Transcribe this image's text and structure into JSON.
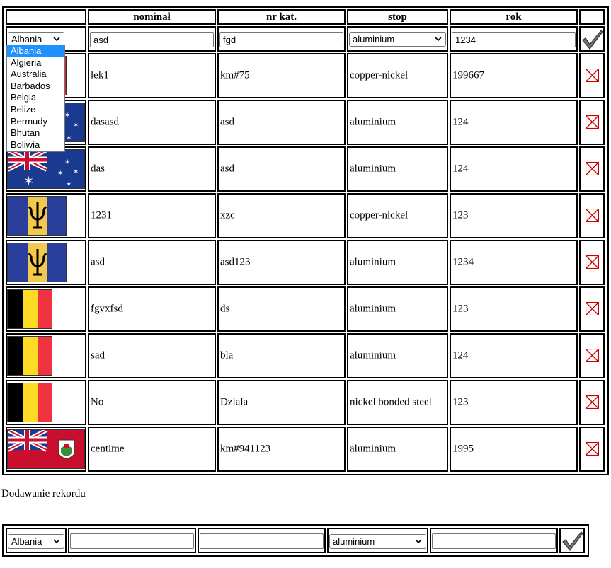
{
  "table": {
    "headers": [
      "",
      "nominał",
      "nr kat.",
      "stop",
      "rok",
      ""
    ],
    "filter_row": {
      "country": "Albania",
      "nominal": "asd",
      "catalog": "fgd",
      "alloy": "aluminium",
      "year": "1234"
    },
    "country_dropdown": {
      "options": [
        "Albania",
        "Algieria",
        "Australia",
        "Barbados",
        "Belgia",
        "Belize",
        "Bermudy",
        "Bhutan",
        "Boliwia"
      ],
      "selected": "Albania"
    },
    "rows": [
      {
        "flag": "albania-flag",
        "nominal": "lek1",
        "catalog": "km#75",
        "alloy": "copper-nickel",
        "year": "199667"
      },
      {
        "flag": "australia-flag",
        "nominal": "dasasd",
        "catalog": "asd",
        "alloy": "aluminium",
        "year": "124"
      },
      {
        "flag": "australia-flag",
        "nominal": "das",
        "catalog": "asd",
        "alloy": "aluminium",
        "year": "124"
      },
      {
        "flag": "barbados-flag",
        "nominal": "1231",
        "catalog": "xzc",
        "alloy": "copper-nickel",
        "year": "123"
      },
      {
        "flag": "barbados-flag",
        "nominal": "asd",
        "catalog": "asd123",
        "alloy": "aluminium",
        "year": "1234"
      },
      {
        "flag": "belgium-flag",
        "nominal": "fgvxfsd",
        "catalog": "ds",
        "alloy": "aluminium",
        "year": "123"
      },
      {
        "flag": "belgium-flag",
        "nominal": "sad",
        "catalog": "bla",
        "alloy": "aluminium",
        "year": "124"
      },
      {
        "flag": "belgium-flag",
        "nominal": "No",
        "catalog": "Dziala",
        "alloy": "nickel bonded steel",
        "year": "123"
      },
      {
        "flag": "bermuda-flag",
        "nominal": "centime",
        "catalog": "km#941123",
        "alloy": "aluminium",
        "year": "1995"
      }
    ]
  },
  "add_section": {
    "caption": "Dodawanie rekordu",
    "country": "Albania",
    "nominal": "",
    "catalog": "",
    "alloy": "aluminium",
    "year": ""
  },
  "colors": {
    "belgium_black": "#000000",
    "belgium_yellow": "#FDDA24",
    "belgium_red": "#EF3340",
    "barbados_blue": "#2A3F9C",
    "barbados_gold": "#F2C94C",
    "delete_red": "#CC0000",
    "dropdown_highlight": "#1E90FF"
  }
}
